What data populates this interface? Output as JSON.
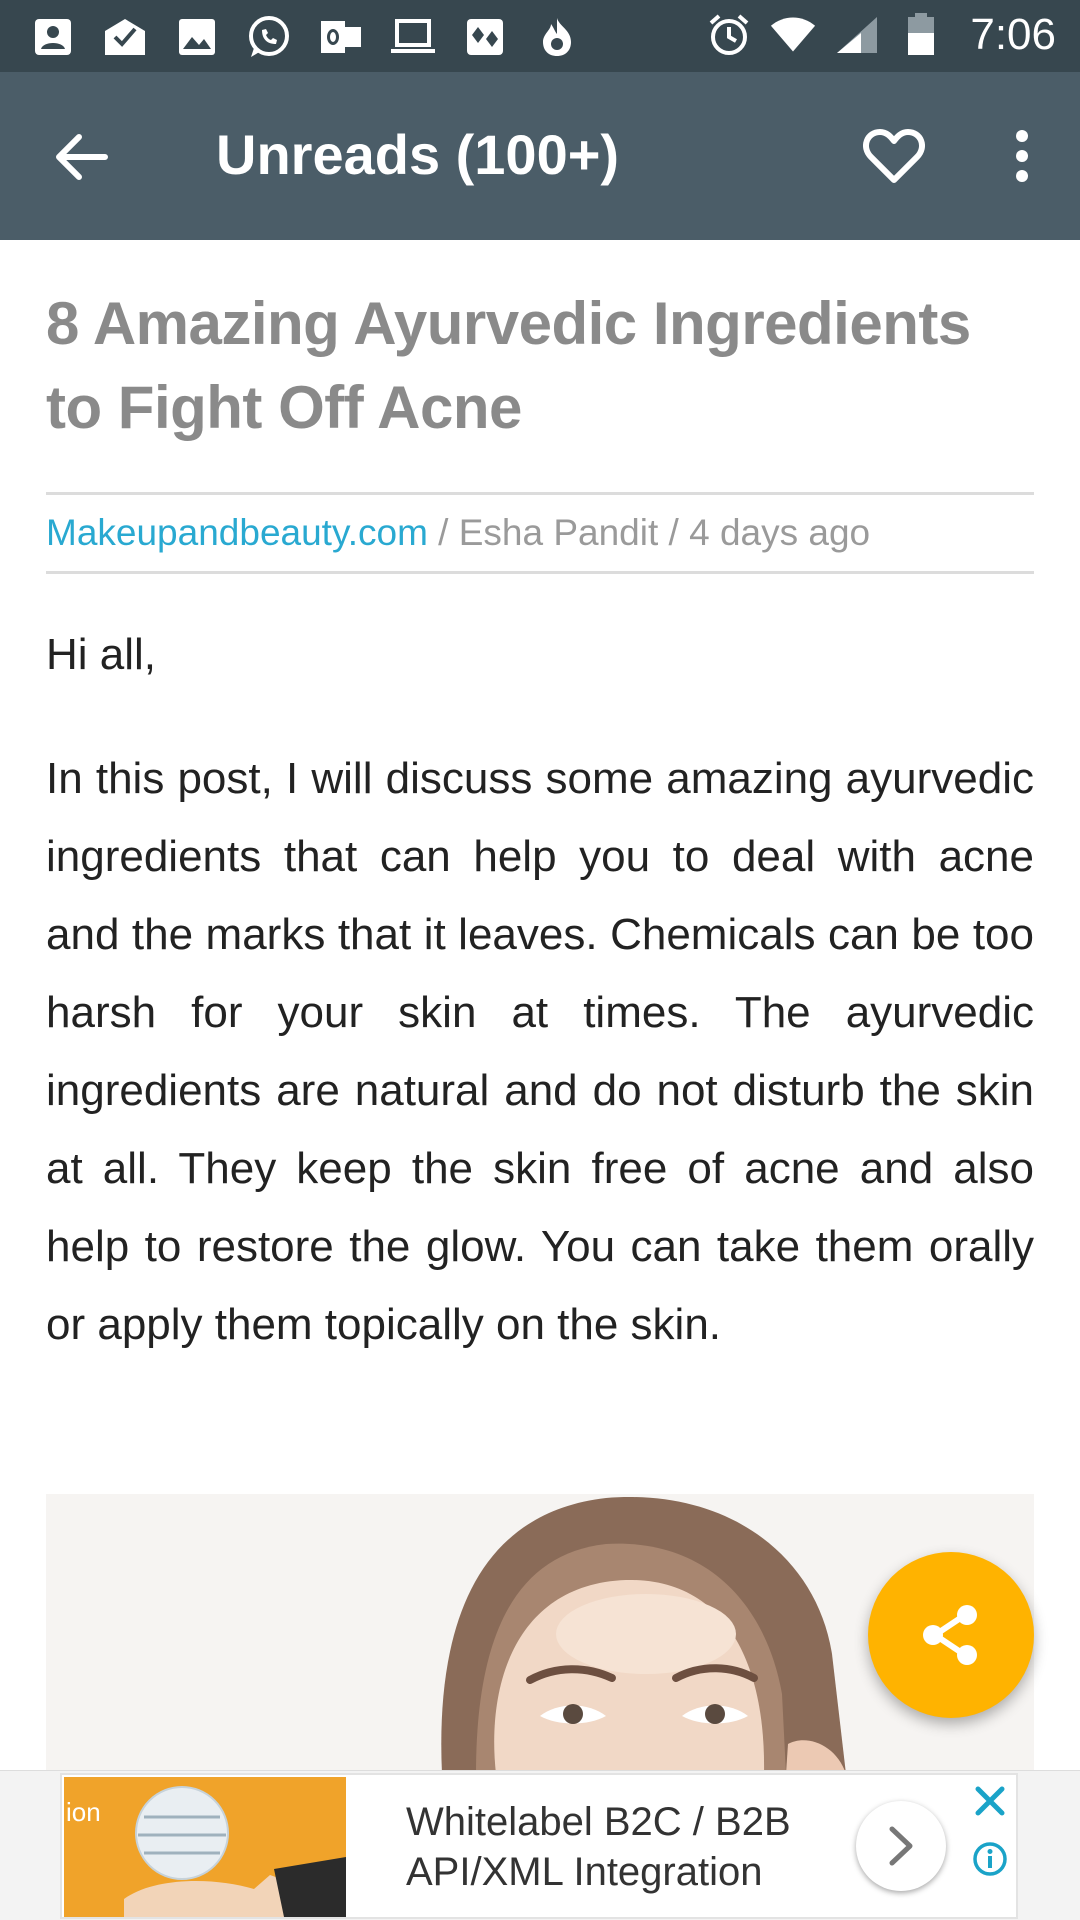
{
  "status_bar": {
    "time": "7:06",
    "left_icons": [
      "contacts-icon",
      "mail-check-icon",
      "image-icon",
      "whatsapp-icon",
      "outlook-icon",
      "laptop-icon",
      "cards-icon",
      "flame-icon"
    ],
    "right_icons": [
      "alarm-icon",
      "wifi-icon",
      "signal-icon",
      "battery-icon"
    ]
  },
  "app_bar": {
    "title": "Unreads (100+)",
    "icons": [
      "back-arrow-icon",
      "heart-icon",
      "more-vert-icon"
    ]
  },
  "article": {
    "title": "8 Amazing Ayurvedic Ingredients to Fight Off Acne",
    "source": "Makeupandbeauty.com",
    "meta_rest": " / Esha Pandit / 4 days ago",
    "greeting": "Hi all,",
    "body": "In this post, I will discuss some amazing ay­urvedic ingredients that can help you to deal with acne and the marks that it leaves. Chem­icals can be too harsh for your skin at times. The ayurvedic ingredients are natural and do not disturb the skin at all. They keep the skin free of acne and also help to restore the glow. You can take them orally or apply them topic­ally on the skin."
  },
  "fab": {
    "icon": "share-icon"
  },
  "ad": {
    "image_text": "ion",
    "line1": "Whitelabel B2C / B2B",
    "line2": "API/XML Integration",
    "icons": [
      "chevron-right-icon",
      "close-icon",
      "info-icon"
    ]
  },
  "colors": {
    "status_bar": "#37474f",
    "app_bar": "#4b5d68",
    "source_link": "#29a9d1",
    "fab": "#ffb300",
    "ad_accent": "#1aa3c8"
  }
}
